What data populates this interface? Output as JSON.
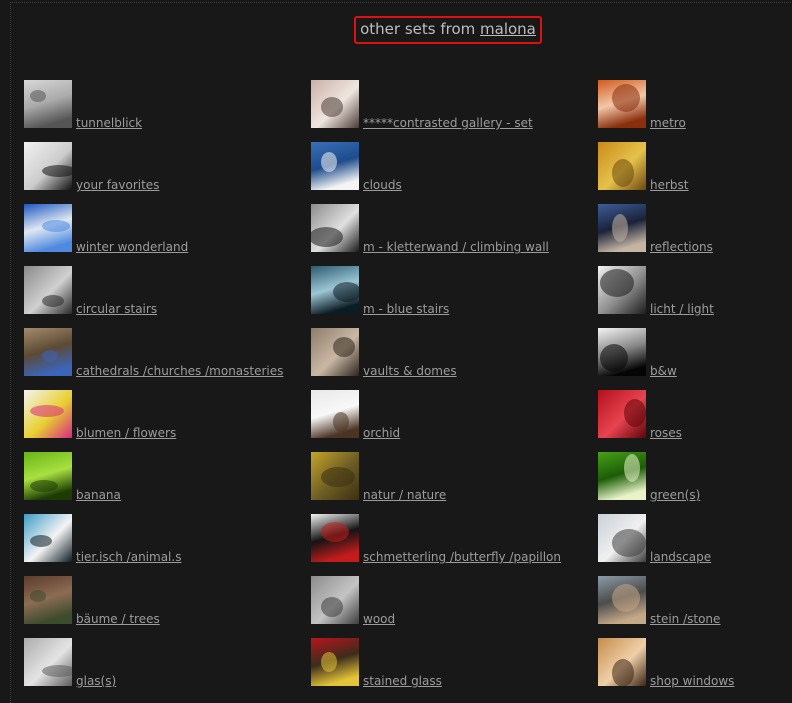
{
  "header": {
    "prefix": "other sets from ",
    "user_link": "malona"
  },
  "sets": [
    {
      "label": "tunnelblick",
      "icon": "tunnel-thumb",
      "colors": [
        "#d8d8d8",
        "#555555",
        "#aaaaaa"
      ]
    },
    {
      "label": "*****contrasted gallery - set",
      "icon": "dome-thumb",
      "colors": [
        "#c9b0a6",
        "#4a3a34",
        "#efe6e0"
      ]
    },
    {
      "label": "metro",
      "icon": "metro-thumb",
      "colors": [
        "#d25a1c",
        "#8a2e0c",
        "#f2c8a8"
      ]
    },
    {
      "label": "your favorites",
      "icon": "lines-thumb",
      "colors": [
        "#f2f2f2",
        "#101010",
        "#cccccc"
      ]
    },
    {
      "label": "clouds",
      "icon": "clouds-thumb",
      "colors": [
        "#3a6fb8",
        "#f4f4f4",
        "#1e4c8c"
      ]
    },
    {
      "label": "herbst",
      "icon": "autumn-thumb",
      "colors": [
        "#c98a1a",
        "#6b4810",
        "#e6c24a"
      ]
    },
    {
      "label": "winter wonderland",
      "icon": "sky-thumb",
      "colors": [
        "#1c56c0",
        "#4f8ae0",
        "#dfe8f2"
      ]
    },
    {
      "label": "m - kletterwand / climbing wall",
      "icon": "wall-thumb",
      "colors": [
        "#8c8c8c",
        "#1a1a1a",
        "#e0e0e0"
      ]
    },
    {
      "label": "reflections",
      "icon": "reflection-thumb",
      "colors": [
        "#3c5e9a",
        "#c4b4a4",
        "#1a2238"
      ]
    },
    {
      "label": "circular stairs",
      "icon": "spiral-thumb",
      "colors": [
        "#8a8a8a",
        "#2a2a2a",
        "#d0d0d0"
      ]
    },
    {
      "label": "m - blue stairs",
      "icon": "blue-stairs-thumb",
      "colors": [
        "#2c5a6e",
        "#0c1c24",
        "#9cc6d6"
      ]
    },
    {
      "label": "licht / light",
      "icon": "lamp-thumb",
      "colors": [
        "#f4f4f4",
        "#1c1c1c",
        "#8c8c8c"
      ]
    },
    {
      "label": "cathedrals /churches /monasteries",
      "icon": "cathedral-thumb",
      "colors": [
        "#a48c6c",
        "#3c64b8",
        "#5c4a34"
      ]
    },
    {
      "label": "vaults & domes",
      "icon": "vault-thumb",
      "colors": [
        "#8c7c6c",
        "#2c241c",
        "#cab8a4"
      ]
    },
    {
      "label": "b&w",
      "icon": "pattern-thumb",
      "colors": [
        "#f4f4f4",
        "#050505",
        "#888888"
      ]
    },
    {
      "label": "blumen / flowers",
      "icon": "flower-thumb",
      "colors": [
        "#f4f4f4",
        "#d82882",
        "#e8d030"
      ]
    },
    {
      "label": "orchid",
      "icon": "orchid-thumb",
      "colors": [
        "#e8e8e8",
        "#4c3424",
        "#f8f8f8"
      ]
    },
    {
      "label": "roses",
      "icon": "roses-thumb",
      "colors": [
        "#b4101c",
        "#5c0408",
        "#e84450"
      ]
    },
    {
      "label": "banana",
      "icon": "banana-leaf-thumb",
      "colors": [
        "#68b418",
        "#1c3c04",
        "#a8e040"
      ]
    },
    {
      "label": "natur / nature",
      "icon": "nature-thumb",
      "colors": [
        "#c4a428",
        "#3c3010",
        "#6c5c24"
      ]
    },
    {
      "label": "green(s)",
      "icon": "leaf-thumb",
      "colors": [
        "#48a018",
        "#e8f4c8",
        "#1c5c08"
      ]
    },
    {
      "label": "tier.isch /animal.s",
      "icon": "penguin-thumb",
      "colors": [
        "#3c9cc4",
        "#0c1c24",
        "#f4f4f4"
      ]
    },
    {
      "label": "schmetterling /butterfly /papillon",
      "icon": "butterfly-thumb",
      "colors": [
        "#f4f4f4",
        "#c41c1c",
        "#141414"
      ]
    },
    {
      "label": "landscape",
      "icon": "landscape-thumb",
      "colors": [
        "#c8d0d8",
        "#3c3c3c",
        "#f0f0f0"
      ]
    },
    {
      "label": "bäume / trees",
      "icon": "tree-thumb",
      "colors": [
        "#5c3c2c",
        "#3c4c2c",
        "#8c6c54"
      ]
    },
    {
      "label": "wood",
      "icon": "wood-thumb",
      "colors": [
        "#8c8c8c",
        "#3c3c3c",
        "#c4c4c4"
      ]
    },
    {
      "label": "stein /stone",
      "icon": "stone-thumb",
      "colors": [
        "#8c9ca8",
        "#c4a888",
        "#4c4c4c"
      ]
    },
    {
      "label": "glas(s)",
      "icon": "glass-thumb",
      "colors": [
        "#acacac",
        "#5c5c5c",
        "#e4e4e4"
      ]
    },
    {
      "label": "stained glass",
      "icon": "stained-glass-thumb",
      "colors": [
        "#b8141c",
        "#e4c438",
        "#3c2c1c"
      ]
    },
    {
      "label": "shop windows",
      "icon": "shop-window-thumb",
      "colors": [
        "#c48c4c",
        "#3c2414",
        "#f0d0a8"
      ]
    }
  ]
}
